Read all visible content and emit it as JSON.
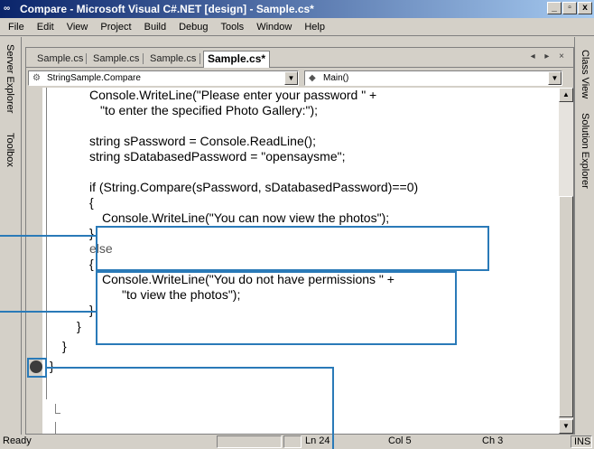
{
  "window": {
    "title": "Compare - Microsoft Visual C#.NET [design] - Sample.cs*",
    "controls": [
      "_",
      "ő",
      "x"
    ]
  },
  "menu": [
    "File",
    "Edit",
    "View",
    "Project",
    "Build",
    "Debug",
    "Tools",
    "Window",
    "Help"
  ],
  "left_dock": [
    "Server Explorer",
    "Toolbox"
  ],
  "right_dock": [
    "Class View",
    "Solution Explorer"
  ],
  "tabs": [
    "Sample.cs",
    "Sample.cs",
    "Sample.cs",
    "Sample.cs*"
  ],
  "tab_controls": "◂ ▸ ×",
  "nav": {
    "class_combo": "StringSample.Compare",
    "member_combo": "Main()"
  },
  "code": {
    "l1": "Console.WriteLine(\"Please enter your password \" +",
    "l2": "\"to enter the specified Photo Gallery:\");",
    "l3": "string sPassword = Console.ReadLine();",
    "l4": "string sDatabasedPassword = \"opensaysme\";",
    "l5": "if (String.Compare(sPassword, sDatabasedPassword)==0)",
    "l6": "{",
    "l7": "Console.WriteLine(\"You can now view the photos\");",
    "l8": "}",
    "l9": "else",
    "l10": "{",
    "l11": "Console.WriteLine(\"You do not have permissions \" +",
    "l12": "\"to view the photos\");",
    "l13": "}",
    "l14": "}",
    "l15": "}",
    "l16": "}"
  },
  "status": {
    "ready": "Ready",
    "ln": "Ln 24",
    "col": "Col 5",
    "ch": "Ch 3",
    "ins": "INS"
  },
  "colors": {
    "callout": "#2a7ab8",
    "title_start": "#0a246a",
    "title_end": "#a6caf0"
  }
}
